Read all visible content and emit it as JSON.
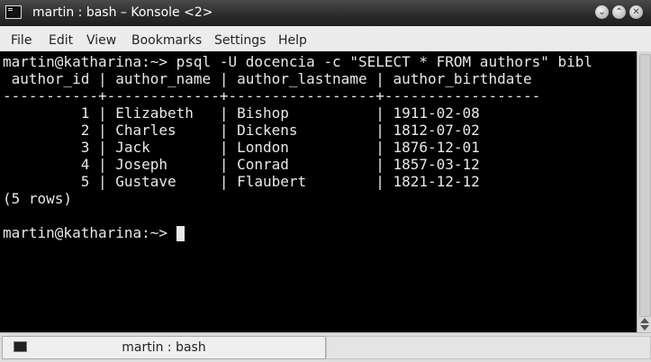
{
  "window": {
    "title": "martin : bash – Konsole <2>",
    "buttons": [
      "⌄",
      "⌃",
      "✕"
    ]
  },
  "menubar": {
    "items": [
      "File",
      "Edit",
      "View",
      "Bookmarks",
      "Settings",
      "Help"
    ]
  },
  "terminal": {
    "lines": [
      "martin@katharina:~> psql -U docencia -c \"SELECT * FROM authors\" bibl",
      " author_id | author_name | author_lastname | author_birthdate",
      "-----------+-------------+-----------------+------------------",
      "         1 | Elizabeth   | Bishop          | 1911-02-08",
      "         2 | Charles     | Dickens         | 1812-07-02",
      "         3 | Jack        | London          | 1876-12-01",
      "         4 | Joseph      | Conrad          | 1857-03-12",
      "         5 | Gustave     | Flaubert        | 1821-12-12",
      "(5 rows)",
      "",
      "martin@katharina:~> "
    ]
  },
  "tabbar": {
    "tab_label": "martin : bash"
  },
  "colors": {
    "terminal_bg": "#000000",
    "terminal_fg": "#e8e8e8"
  }
}
